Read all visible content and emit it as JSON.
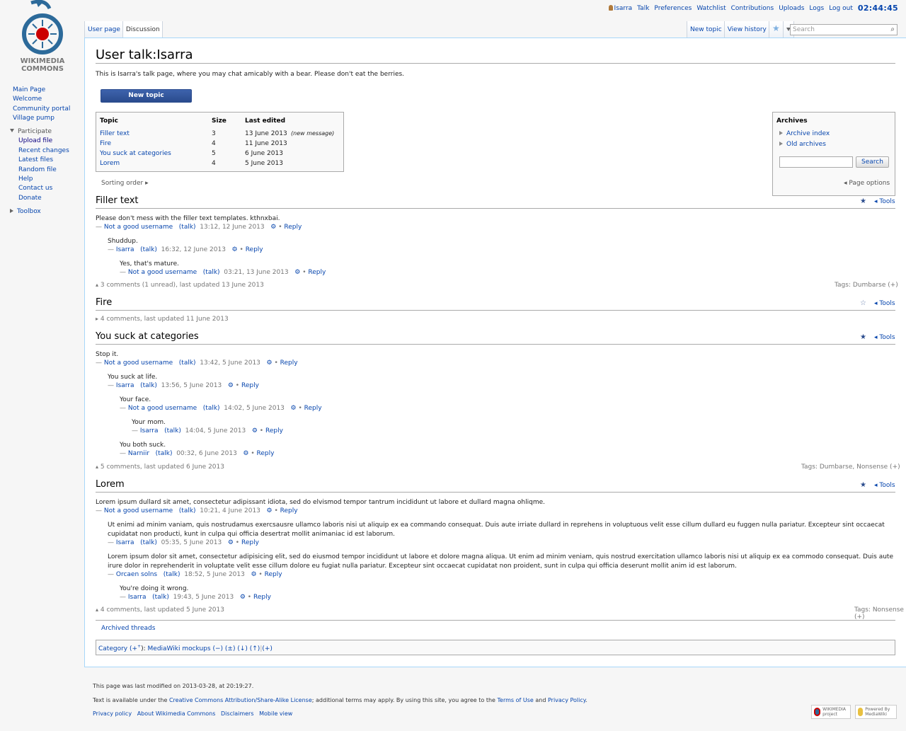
{
  "logo": {
    "line1": "WIKIMEDIA",
    "line2": "COMMONS"
  },
  "personal": {
    "user": "Isarra",
    "talk": "Talk",
    "preferences": "Preferences",
    "watchlist": "Watchlist",
    "contributions": "Contributions",
    "uploads": "Uploads",
    "logs": "Logs",
    "logout": "Log out",
    "clock": "02:44:45"
  },
  "nav": [
    "Main Page",
    "Welcome",
    "Community portal",
    "Village pump"
  ],
  "participate": {
    "heading": "Participate",
    "items": [
      "Upload file",
      "Recent changes",
      "Latest files",
      "Random file",
      "Help",
      "Contact us",
      "Donate"
    ]
  },
  "toolbox": "Toolbox",
  "tabs": {
    "user_page": "User page",
    "discussion": "Discussion",
    "new_topic": "New topic",
    "view_history": "View history"
  },
  "search": {
    "placeholder": "Search"
  },
  "page": {
    "title": "User talk:Isarra",
    "intro": "This is Isarra's talk page, where you may chat amicably with a bear. Please don't eat the berries.",
    "new_topic_button": "New topic",
    "toc_headers": [
      "Topic",
      "Size",
      "Last edited"
    ],
    "toc_rows": [
      {
        "topic": "Filler text",
        "size": "3",
        "date": "13 June 2013",
        "note": "(new message)"
      },
      {
        "topic": "Fire",
        "size": "4",
        "date": "11 June 2013",
        "note": ""
      },
      {
        "topic": "You suck at categories",
        "size": "5",
        "date": "6 June 2013",
        "note": ""
      },
      {
        "topic": "Lorem",
        "size": "4",
        "date": "5 June 2013",
        "note": ""
      }
    ],
    "sorting_order": "Sorting order ▸",
    "page_options": "◂ Page options",
    "archives": {
      "heading": "Archives",
      "links": [
        "Archive index",
        "Old archives"
      ],
      "search_button": "Search"
    },
    "tools_label": "◂ Tools",
    "archived_threads": "Archived threads",
    "category": {
      "label": "Category",
      "plus": "(+",
      "plus_sup": "+",
      "close": "):",
      "name": "MediaWiki mockups",
      "ops": "(−) (±) (↓) (↑)",
      "add": "(+)"
    }
  },
  "sig": {
    "dash": "—",
    "talk": "(talk)",
    "gear": "⚙",
    "bullet": "•",
    "reply": "Reply"
  },
  "threads": {
    "filler": {
      "title": "Filler text",
      "posts": [
        {
          "text": "Please don't mess with the filler text templates. kthnxbai.",
          "user": "Not a good username",
          "time": "13:12, 12 June 2013"
        },
        {
          "text": "Shuddup.",
          "user": "Isarra",
          "time": "16:32, 12 June 2013"
        },
        {
          "text": "Yes, that's mature.",
          "user": "Not a good username",
          "time": "03:21, 13 June 2013"
        }
      ],
      "summary": "3 comments (1 unread), last updated 13 June 2013",
      "tags": "Tags: Dumbarse (+)"
    },
    "fire": {
      "title": "Fire",
      "summary": "4 comments, last updated 11 June 2013"
    },
    "cats": {
      "title": "You suck at categories",
      "posts": [
        {
          "text": "Stop it.",
          "user": "Not a good username",
          "time": "13:42, 5 June 2013"
        },
        {
          "text": "You suck at life.",
          "user": "Isarra",
          "time": "13:56, 5 June 2013"
        },
        {
          "text": "Your face.",
          "user": "Not a good username",
          "time": "14:02, 5 June 2013"
        },
        {
          "text": "Your mom.",
          "user": "Isarra",
          "time": "14:04, 5 June 2013"
        },
        {
          "text": "You both suck.",
          "user": "Narniir",
          "time": "00:32, 6 June 2013"
        }
      ],
      "summary": "5 comments, last updated 6 June 2013",
      "tags": "Tags: Dumbarse, Nonsense (+)"
    },
    "lorem": {
      "title": "Lorem",
      "posts": [
        {
          "text": "Lorem ipsum dullard sit amet, consectetur adipissant idiota, sed do elvismod tempor tantrum incididunt ut labore et dullard magna ohliqme.",
          "user": "Not a good username",
          "time": "10:21, 4 June 2013"
        },
        {
          "text": "Ut enimi ad minim vaniam, quis nostrudamus exercsausre ullamco laboris nisi ut aliquip ex ea commando consequat. Duis aute irriate dullard in reprehens in voluptuous velit esse cillum dullard eu fuggen nulla pariatur. Excepteur sint occaecat cupidatat non producti, kunt in culpa qui officia desertrat mollit animaniac id est laborum.",
          "user": "Isarra",
          "time": "05:35, 5 June 2013"
        },
        {
          "text": "Lorem ipsum dolor sit amet, consectetur adipisicing elit, sed do eiusmod tempor incididunt ut labore et dolore magna aliqua. Ut enim ad minim veniam, quis nostrud exercitation ullamco laboris nisi ut aliquip ex ea commodo consequat. Duis aute irure dolor in reprehenderit in voluptate velit esse cillum dolore eu fugiat nulla pariatur. Excepteur sint occaecat cupidatat non proident, sunt in culpa qui officia deserunt mollit anim id est laborum.",
          "user": "Orcaen solns",
          "time": "18:52, 5 June 2013"
        },
        {
          "text": "You're doing it wrong.",
          "user": "Isarra",
          "time": "19:43, 5 June 2013"
        }
      ],
      "summary": "4 comments, last updated 5 June 2013",
      "tags": "Tags: Nonsense (+)"
    }
  },
  "footer": {
    "modified": "This page was last modified on 2013-03-28, at 20:19:27.",
    "license_pre": "Text is available under the",
    "license_link": "Creative Commons Attribution/Share-Alike License",
    "license_mid": "; additional terms may apply. By using this site, you agree to the",
    "terms": "Terms of Use",
    "and": "and",
    "privacy": "Privacy Policy",
    "links": [
      "Privacy policy",
      "About Wikimedia Commons",
      "Disclaimers",
      "Mobile view"
    ],
    "badge1": "WIKIMEDIA project",
    "badge2": "Powered By MediaWiki"
  }
}
